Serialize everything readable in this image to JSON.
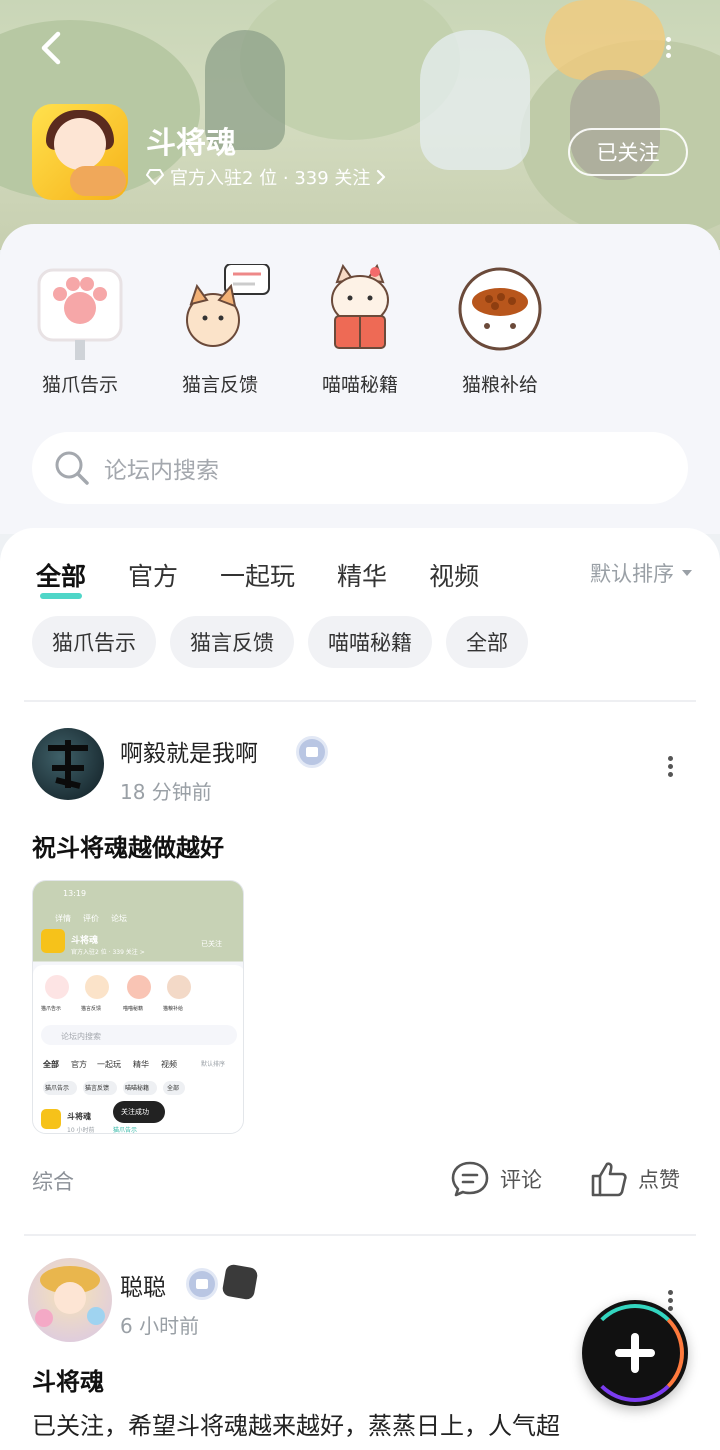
{
  "header": {
    "title": "斗将魂",
    "meta": "官方入驻2 位 · 339 关注",
    "follow_label": "已关注"
  },
  "categories": [
    {
      "label": "猫爪告示",
      "icon": "paw-sign-icon"
    },
    {
      "label": "猫言反馈",
      "icon": "cat-feedback-icon"
    },
    {
      "label": "喵喵秘籍",
      "icon": "cat-book-icon"
    },
    {
      "label": "猫粮补给",
      "icon": "cat-food-bowl-icon"
    }
  ],
  "search": {
    "placeholder": "论坛内搜索"
  },
  "tabs": [
    "全部",
    "官方",
    "一起玩",
    "精华",
    "视频"
  ],
  "sort_label": "默认排序",
  "chips": [
    "猫爪告示",
    "猫言反馈",
    "喵喵秘籍",
    "全部"
  ],
  "posts": [
    {
      "username": "啊毅就是我啊",
      "time": "18 分钟前",
      "title": "祝斗将魂越做越好",
      "tag": "综合",
      "comment_label": "评论",
      "like_label": "点赞",
      "thumbnail": {
        "time": "13:19",
        "tabs": [
          "详情",
          "评价",
          "论坛"
        ],
        "title": "斗将魂",
        "meta": "官方入驻2 位 · 339 关注 >",
        "follow": "已关注",
        "cats": [
          "猫爪告示",
          "猫言反馈",
          "喵喵秘籍",
          "猫粮补给"
        ],
        "search": "论坛内搜索",
        "tabs2": [
          "全部",
          "官方",
          "一起玩",
          "精华",
          "视频"
        ],
        "sort": "默认排序",
        "chips": [
          "猫爪告示",
          "猫言反馈",
          "喵喵秘籍",
          "全部"
        ],
        "post_user": "斗将魂",
        "post_meta": "10 小时前",
        "post_tag": "猫爪告示",
        "toast": "关注成功"
      }
    },
    {
      "username": "聪聪",
      "time": "6 小时前",
      "title": "斗将魂",
      "body": "已关注，希望斗将魂越来越好，蒸蒸日上，人气超"
    }
  ],
  "colors": {
    "accent": "#4fd6c8",
    "fab_ring_1": "#33d6c0",
    "fab_ring_2": "#ff7a3d",
    "fab_ring_3": "#7b3cf0"
  }
}
